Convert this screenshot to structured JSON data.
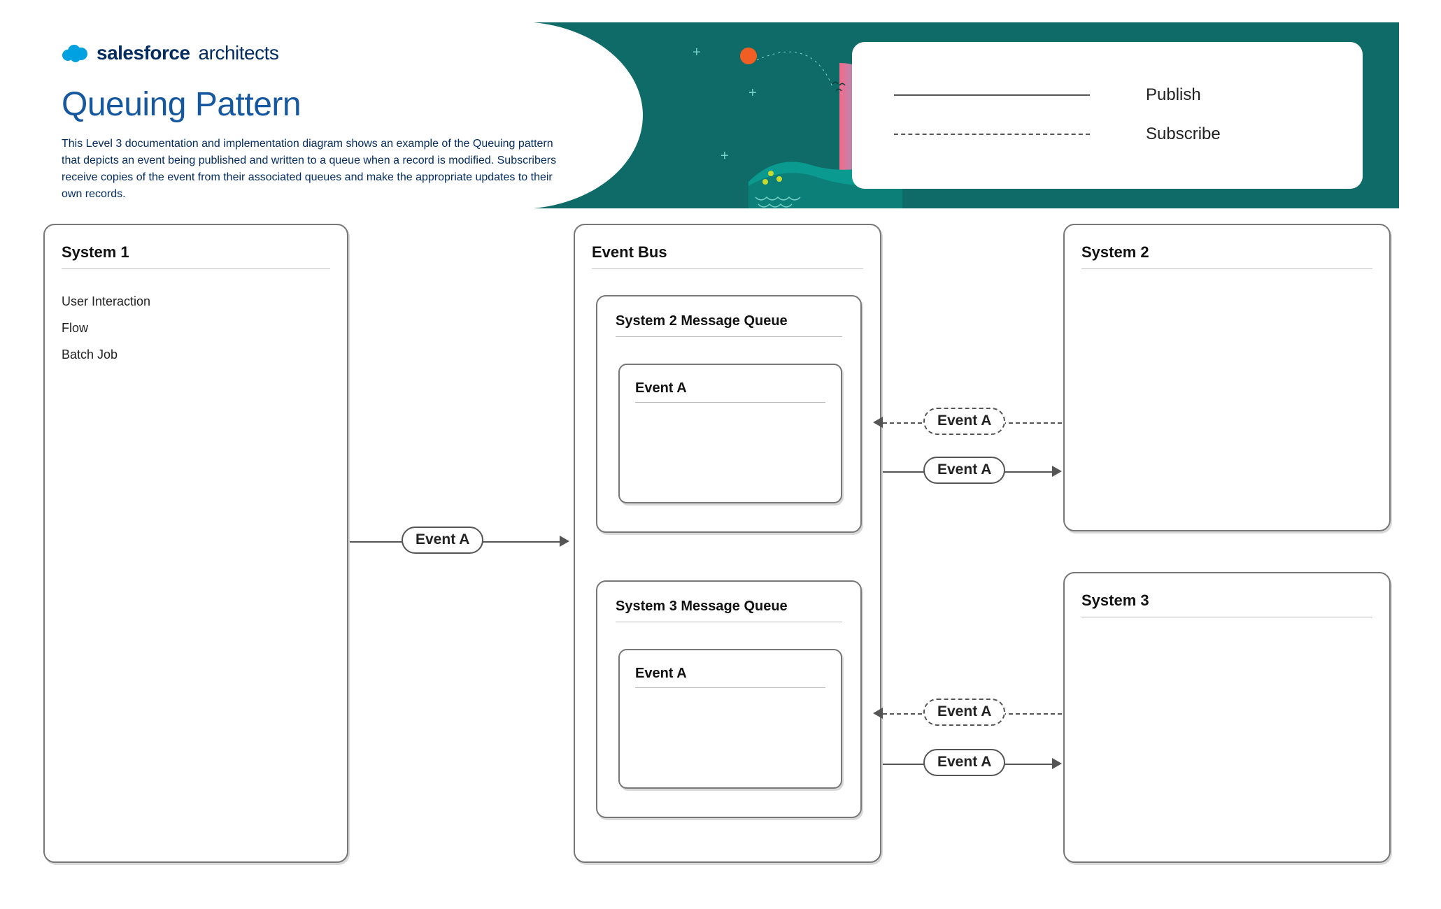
{
  "brand": {
    "word1": "salesforce",
    "word2": "architects"
  },
  "header": {
    "title": "Queuing Pattern",
    "description": "This Level 3 documentation and implementation diagram  shows an example of the Queuing pattern that depicts an event being published  and written to a queue when a record is modified.  Subscribers receive copies of the event from their associated queues and make the appropriate updates to their own records."
  },
  "legend": {
    "publish": "Publish",
    "subscribe": "Subscribe"
  },
  "system1": {
    "title": "System 1",
    "items": [
      "User Interaction",
      "Flow",
      "Batch Job"
    ]
  },
  "event_bus": {
    "title": "Event Bus"
  },
  "queue_sys2": {
    "title": "System 2 Message Queue",
    "event": "Event A"
  },
  "queue_sys3": {
    "title": "System 3 Message Queue",
    "event": "Event A"
  },
  "system2": {
    "title": "System 2"
  },
  "system3": {
    "title": "System 3"
  },
  "connectors": {
    "s1_to_bus": "Event A",
    "sys2_sub": "Event A",
    "sys2_pub": "Event A",
    "sys3_sub": "Event A",
    "sys3_pub": "Event A"
  },
  "colors": {
    "teal": "#0f6b67",
    "brand_blue": "#032d60",
    "title_blue": "#1658a0",
    "accent_orange": "#f05e23",
    "accent_yellow": "#c6d92c",
    "accent_cyan": "#36c5f0"
  }
}
